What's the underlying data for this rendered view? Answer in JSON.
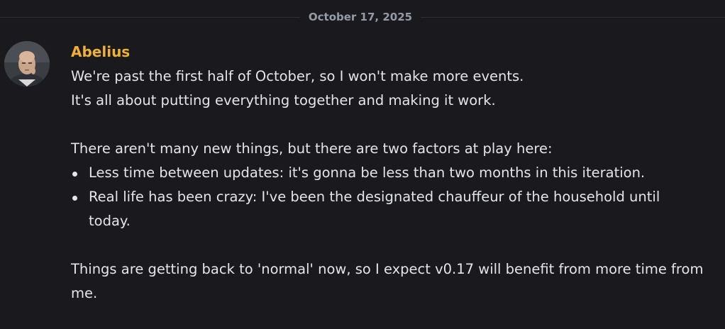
{
  "divider": {
    "date": "October 17, 2025"
  },
  "message": {
    "author": "Abelius",
    "author_color": "#f0b132",
    "avatar_icon": "avatar-icon",
    "lines": [
      "We're past the first half of October, so I won't make more events.",
      "It's all about putting everything together and making it work."
    ],
    "intro": "There aren't many new things, but there are two factors at play here:",
    "bullets": [
      "Less time between updates: it's gonna be less than two months in this iteration.",
      "Real life has been crazy: I've been the designated chauffeur of the household until today."
    ],
    "closing": "Things are getting back to 'normal' now, so I expect v0.17 will benefit from more time from me."
  }
}
